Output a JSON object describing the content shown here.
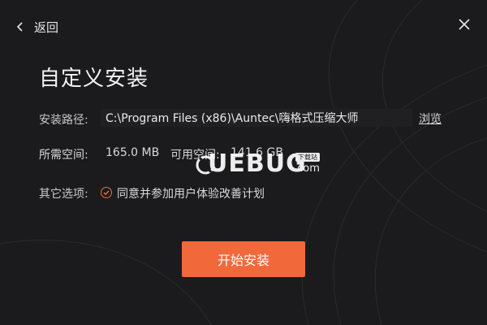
{
  "header": {
    "back_label": "返回"
  },
  "title": "自定义安装",
  "install_path": {
    "label": "安装路径:",
    "value": "C:\\Program Files (x86)\\Auntec\\嗨格式压缩大师",
    "browse_label": "浏览"
  },
  "space": {
    "required_label": "所需空间:",
    "required_value": "165.0 MB",
    "available_label": "可用空间:",
    "available_value": "141.6 GB"
  },
  "options": {
    "label": "其它选项:",
    "checkbox_label": "同意并参加用户体验改善计划",
    "checked": true
  },
  "install_button": "开始安装",
  "watermark": {
    "brand": "UEBUG",
    "suffix": ".com",
    "badge": "下载站"
  },
  "colors": {
    "accent": "#f1683a",
    "background": "#1b1b1d"
  }
}
